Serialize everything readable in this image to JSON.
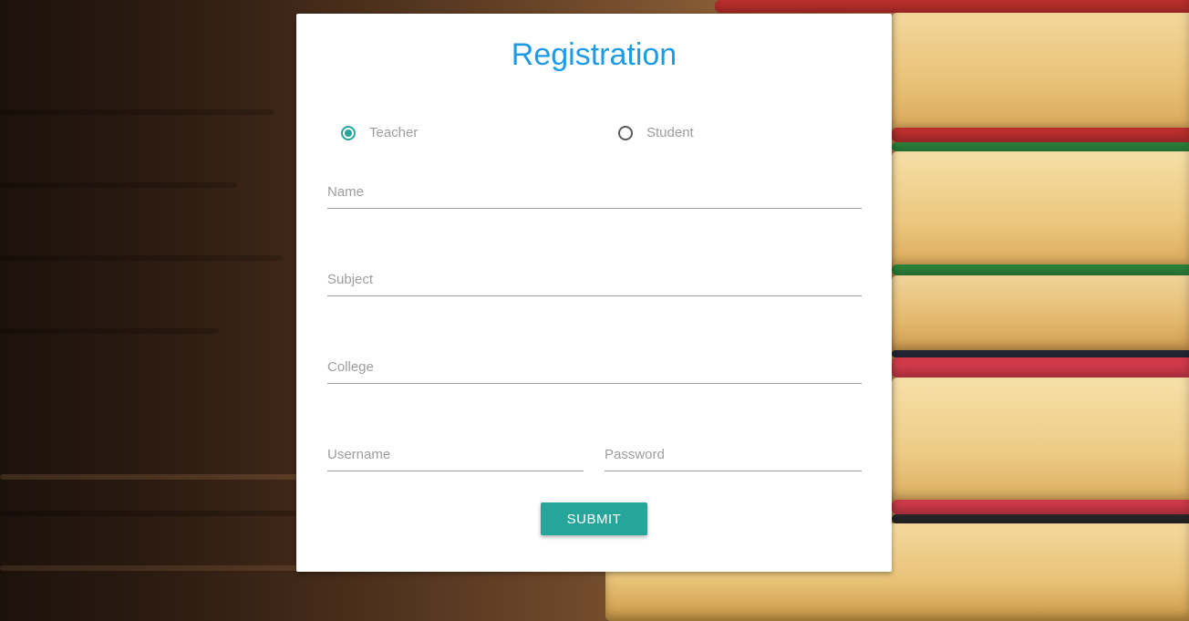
{
  "form": {
    "title": "Registration",
    "roles": [
      {
        "label": "Teacher",
        "checked": true
      },
      {
        "label": "Student",
        "checked": false
      }
    ],
    "fields": {
      "name_placeholder": "Name",
      "subject_placeholder": "Subject",
      "college_placeholder": "College",
      "username_placeholder": "Username",
      "password_placeholder": "Password"
    },
    "submit_label": "SUBMIT"
  },
  "colors": {
    "accent": "#26a69a",
    "title": "#1e9be4",
    "placeholder": "#9e9e9e"
  }
}
